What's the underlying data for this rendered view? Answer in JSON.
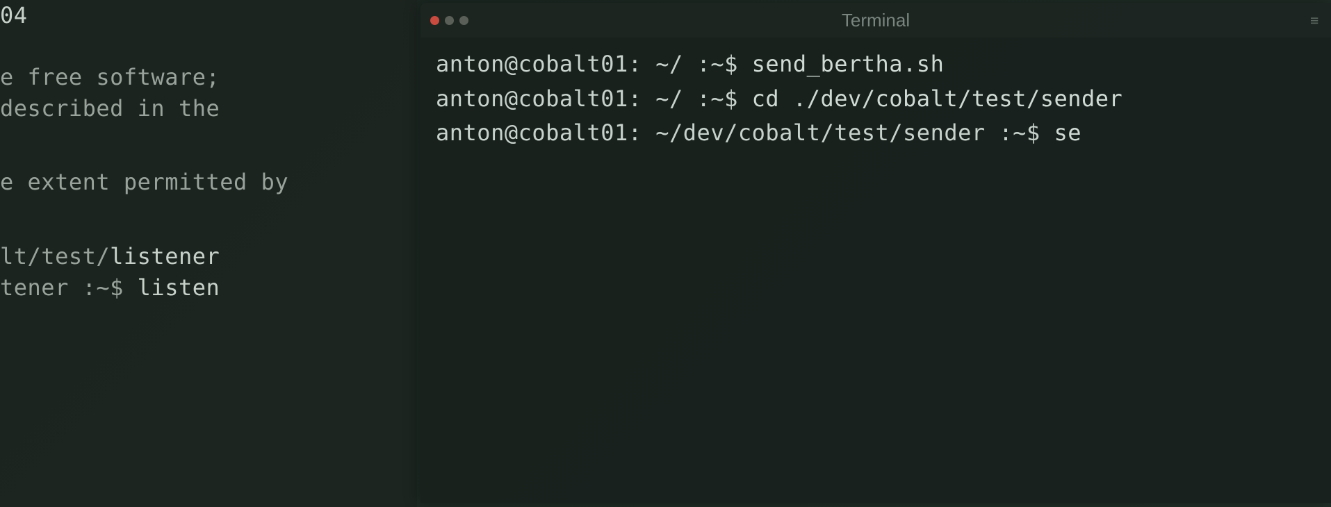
{
  "left_terminal": {
    "lines": [
      {
        "text": "04",
        "class": "bright",
        "margin_top": 0
      },
      {
        "text": "",
        "spacer": true
      },
      {
        "text": "e free software;",
        "class": "dim"
      },
      {
        "text": " described in the",
        "class": "dim"
      },
      {
        "text": "",
        "spacer": true
      },
      {
        "text": "",
        "spacer_sm": true
      },
      {
        "text": "e extent permitted by",
        "class": "dim"
      },
      {
        "text": "",
        "spacer": true
      },
      {
        "text": "",
        "spacer_sm": true
      },
      {
        "text_parts": [
          {
            "text": "lt/test/",
            "class": "dim"
          },
          {
            "text": "listener",
            "class": "bright"
          }
        ]
      },
      {
        "text_parts": [
          {
            "text": "tener :~$  ",
            "class": "dim"
          },
          {
            "text": "listen",
            "class": "bright"
          }
        ]
      }
    ]
  },
  "right_terminal": {
    "title": "Terminal",
    "lines": [
      {
        "prompt_user": "anton@cobalt01:",
        "prompt_path": " ~/ ",
        "prompt_symbol": ":~$ ",
        "command": "send_bertha.sh"
      },
      {
        "prompt_user": "anton@cobalt01:",
        "prompt_path": " ~/ ",
        "prompt_symbol": ":~$ ",
        "command": "cd ./dev/cobalt/test/sender"
      },
      {
        "prompt_user": "anton@cobalt01:",
        "prompt_path": " ~/dev/cobalt/test/sender ",
        "prompt_symbol": ":~$",
        "command": ""
      }
    ],
    "partial_input": "se"
  }
}
